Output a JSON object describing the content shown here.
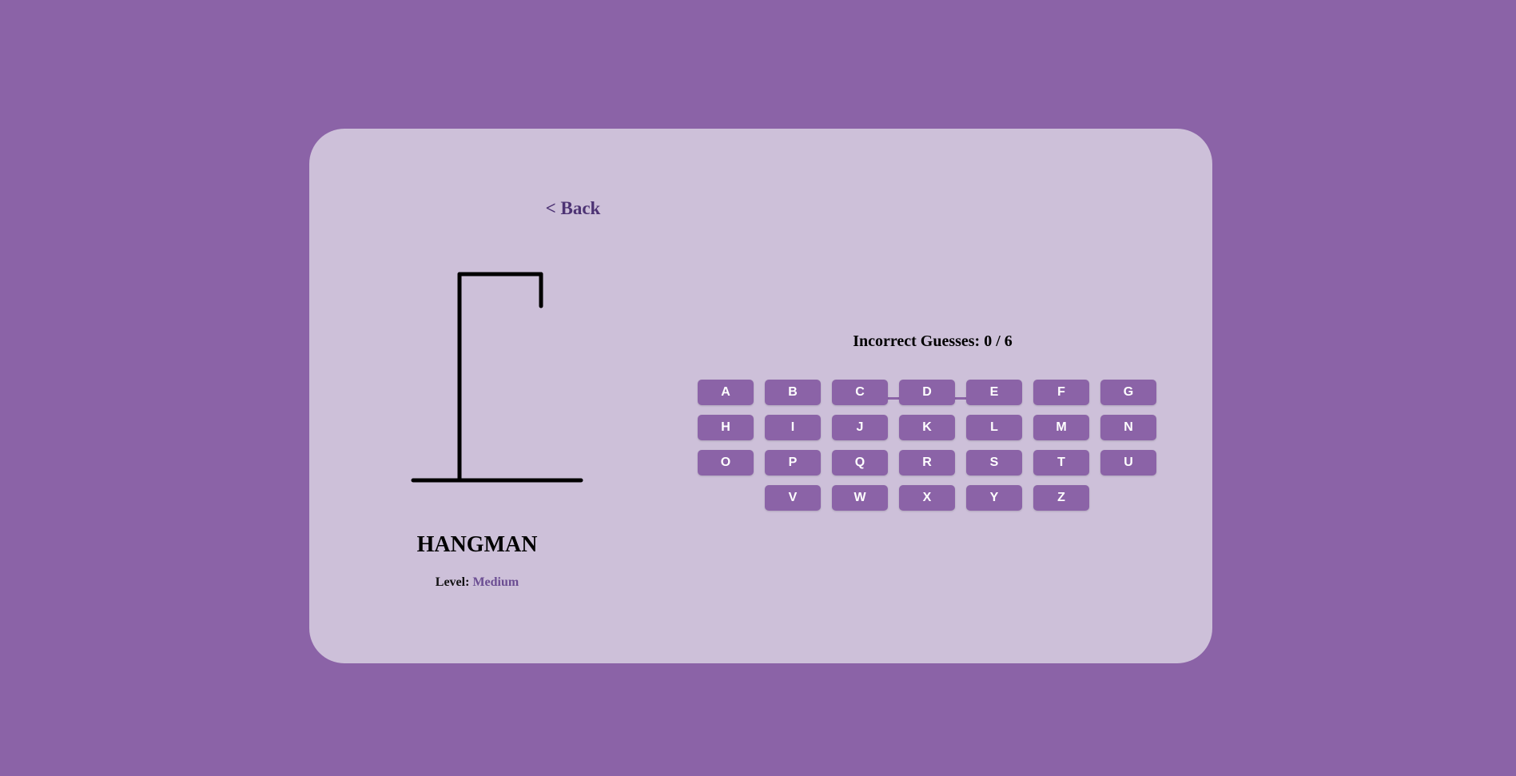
{
  "nav": {
    "back_label": "< Back"
  },
  "game": {
    "title": "HANGMAN",
    "level_label": "Level:",
    "level_value": "Medium",
    "word_blanks": [
      "",
      "",
      "",
      ""
    ],
    "incorrect_label": "Incorrect Guesses:",
    "incorrect_count": "0 / 6"
  },
  "keyboard": {
    "rows": [
      [
        "A",
        "B",
        "C",
        "D",
        "E",
        "F",
        "G"
      ],
      [
        "H",
        "I",
        "J",
        "K",
        "L",
        "M",
        "N"
      ],
      [
        "O",
        "P",
        "Q",
        "R",
        "S",
        "T",
        "U"
      ],
      [
        "V",
        "W",
        "X",
        "Y",
        "Z"
      ]
    ]
  },
  "colors": {
    "background": "#8b63a7",
    "card": "#cdc0d9",
    "accent": "#8b63a7",
    "link": "#4d3374"
  }
}
